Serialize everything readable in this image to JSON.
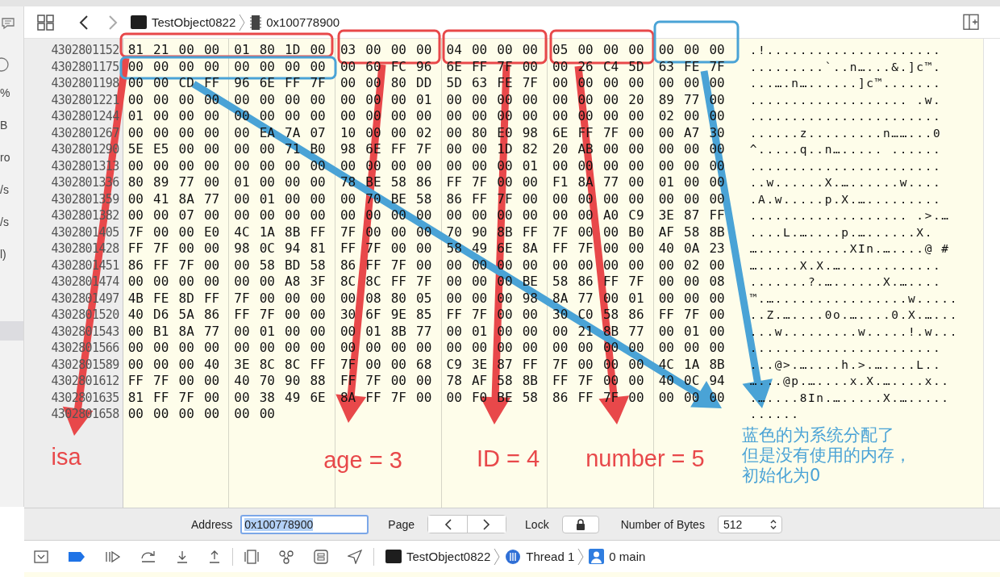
{
  "sidebar_fragments": [
    "%",
    "B",
    "ro",
    "/s",
    "/s",
    "l)"
  ],
  "jump_bar": [
    {
      "kind": "target",
      "label": "TestObject0822"
    },
    {
      "kind": "memory",
      "label": "0x100778900"
    }
  ],
  "memory": {
    "rows": [
      {
        "address": "4302801152",
        "bytes": "81 21 00 00 01 80 1D 00 03 00 00 00 04 00 00 00 05 00 00 00 00 00 00",
        "ascii": ".!....................."
      },
      {
        "address": "4302801175",
        "bytes": "00 00 00 00 00 00 00 00 00 60 FC 96 6E FF 7F 00 00 26 C4 5D 63 FE 7F",
        "ascii": ".........`..n…...&.]c™."
      },
      {
        "address": "4302801198",
        "bytes": "00 00 CD FF 96 6E FF 7F 00 00 80 DD 5D 63 FE 7F 00 00 00 00 00 00 00",
        "ascii": "...….n…......]c™......."
      },
      {
        "address": "4302801221",
        "bytes": "00 00 00 00 00 00 00 00 00 00 00 01 00 00 00 00 00 00 00 20 89 77 00",
        "ascii": "................... .w."
      },
      {
        "address": "4302801244",
        "bytes": "01 00 00 00 00 00 00 00 00 00 00 00 00 00 00 00 00 00 00 00 02 00 00",
        "ascii": "......................."
      },
      {
        "address": "4302801267",
        "bytes": "00 00 00 00 00 EA 7A 07 10 00 00 02 00 80 E0 98 6E FF 7F 00 00 A7 30",
        "ascii": "......z.........n……...0"
      },
      {
        "address": "4302801290",
        "bytes": "5E E5 00 00 00 00 71 B0 98 6E FF 7F 00 00 1D 82 20 AB 00 00 00 00 00",
        "ascii": "^.....q..n…..... ......"
      },
      {
        "address": "4302801313",
        "bytes": "00 00 00 00 00 00 00 00 00 00 00 00 00 00 00 01 00 00 00 00 00 00 00",
        "ascii": "......................."
      },
      {
        "address": "4302801336",
        "bytes": "80 89 77 00 01 00 00 00 78 BE 58 86 FF 7F 00 00 F1 8A 77 00 01 00 00",
        "ascii": "..w......X.…......w...."
      },
      {
        "address": "4302801359",
        "bytes": "00 41 8A 77 00 01 00 00 00 70 BE 58 86 FF 7F 00 00 00 00 00 00 00 00",
        "ascii": ".A.w.....p.X.…........."
      },
      {
        "address": "4302801382",
        "bytes": "00 00 07 00 00 00 00 00 00 00 00 00 00 00 00 00 00 00 A0 C9 3E 87 FF",
        "ascii": "................... .>.…"
      },
      {
        "address": "4302801405",
        "bytes": "7F 00 00 E0 4C 1A 8B FF 7F 00 00 00 70 90 8B FF 7F 00 00 B0 AF 58 8B",
        "ascii": "....L.…....p.…......X."
      },
      {
        "address": "4302801428",
        "bytes": "FF 7F 00 00 98 0C 94 81 FF 7F 00 00 58 49 6E 8A FF 7F 00 00 40 0A 23",
        "ascii": "…...........XIn.…....@ #"
      },
      {
        "address": "4302801451",
        "bytes": "86 FF 7F 00 00 58 BD 58 86 FF 7F 00 00 00 00 00 00 00 00 00 00 02 00",
        "ascii": "….....X.X.…............"
      },
      {
        "address": "4302801474",
        "bytes": "00 00 00 00 00 00 A8 3F 8C 8C FF 7F 00 00 00 BE 58 86 FF 7F 00 00 08",
        "ascii": ".......?.…......X.…...."
      },
      {
        "address": "4302801497",
        "bytes": "4B FE 8D FF 7F 00 00 00 00 08 80 05 00 00 00 98 8A 77 00 01 00 00 00",
        "ascii": "™.…................w....."
      },
      {
        "address": "4302801520",
        "bytes": "40 D6 5A 86 FF 7F 00 00 30 6F 9E 85 FF 7F 00 00 30 C0 58 86 FF 7F 00",
        "ascii": "..Z.…....0o.…....0.X.…..."
      },
      {
        "address": "4302801543",
        "bytes": "00 B1 8A 77 00 01 00 00 00 01 8B 77 00 01 00 00 00 21 8B 77 00 01 00",
        "ascii": "...w.........w.....!.w..."
      },
      {
        "address": "4302801566",
        "bytes": "00 00 00 00 00 00 00 00 00 00 00 00 00 00 00 00 00 00 00 00 00 00 00",
        "ascii": "......................."
      },
      {
        "address": "4302801589",
        "bytes": "00 00 00 40 3E 8C 8C FF 7F 00 00 68 C9 3E 87 FF 7F 00 00 00 4C 1A 8B",
        "ascii": "...@>.…....h.>.…....L.."
      },
      {
        "address": "4302801612",
        "bytes": "FF 7F 00 00 40 70 90 88 FF 7F 00 00 78 AF 58 8B FF 7F 00 00 40 0C 94",
        "ascii": "…...@p.…....x.X.…....x.."
      },
      {
        "address": "4302801635",
        "bytes": "81 FF 7F 00 00 38 49 6E 8A FF 7F 00 00 F0 BE 58 86 FF 7F 00 00 00 00",
        "ascii": ".…....8In.….....X.…....."
      },
      {
        "address": "4302801658",
        "bytes": "00 00 00 00 00 00",
        "ascii": "......"
      }
    ]
  },
  "callouts": [
    {
      "kind": "field",
      "label": "isa"
    },
    {
      "kind": "field",
      "label": "age = 3"
    },
    {
      "kind": "field",
      "label": "ID = 4"
    },
    {
      "kind": "field",
      "label": "number = 5"
    },
    {
      "kind": "unused",
      "lines": [
        "蓝色的为系统分配了",
        "但是没有使用的内存，",
        "初始化为0"
      ]
    }
  ],
  "memory_bar": {
    "address_label": "Address",
    "address": "0x100778900",
    "page_label": "Page",
    "lock_label": "Lock",
    "bytes_label": "Number of Bytes",
    "bytes_value": "512"
  },
  "debug_bar": [
    {
      "kind": "target",
      "label": "TestObject0822"
    },
    {
      "kind": "thread",
      "label": "Thread 1"
    },
    {
      "kind": "frame",
      "label": "0 main"
    }
  ]
}
